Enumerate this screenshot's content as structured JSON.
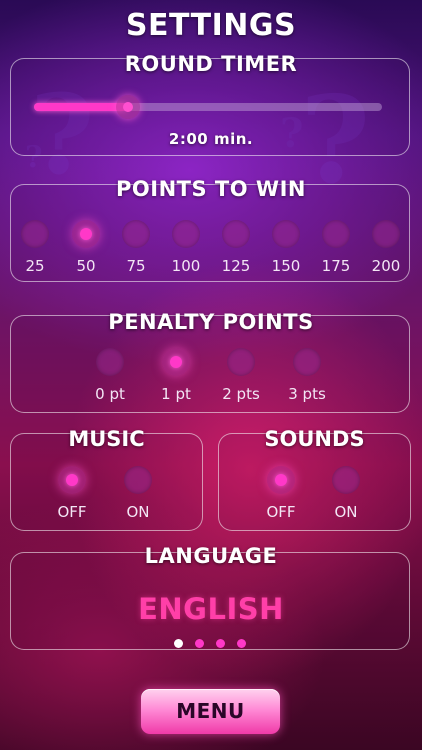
{
  "title": "SETTINGS",
  "round_timer": {
    "heading": "ROUND TIMER",
    "value_label": "2:00 min.",
    "slider_fraction": 0.27
  },
  "points_to_win": {
    "heading": "POINTS TO WIN",
    "options": [
      "25",
      "50",
      "75",
      "100",
      "125",
      "150",
      "175",
      "200"
    ],
    "selected_index": 1
  },
  "penalty_points": {
    "heading": "PENALTY POINTS",
    "options": [
      "0 pt",
      "1 pt",
      "2 pts",
      "3 pts"
    ],
    "selected_index": 1
  },
  "music": {
    "heading": "MUSIC",
    "options": [
      "OFF",
      "ON"
    ],
    "selected_index": 0
  },
  "sounds": {
    "heading": "SOUNDS",
    "options": [
      "OFF",
      "ON"
    ],
    "selected_index": 0
  },
  "language": {
    "heading": "LANGUAGE",
    "value": "ENGLISH",
    "page_count": 4,
    "active_page": 0
  },
  "menu_label": "MENU",
  "colors": {
    "accent": "#ff38c8",
    "language_text": "#ff3fa8"
  }
}
